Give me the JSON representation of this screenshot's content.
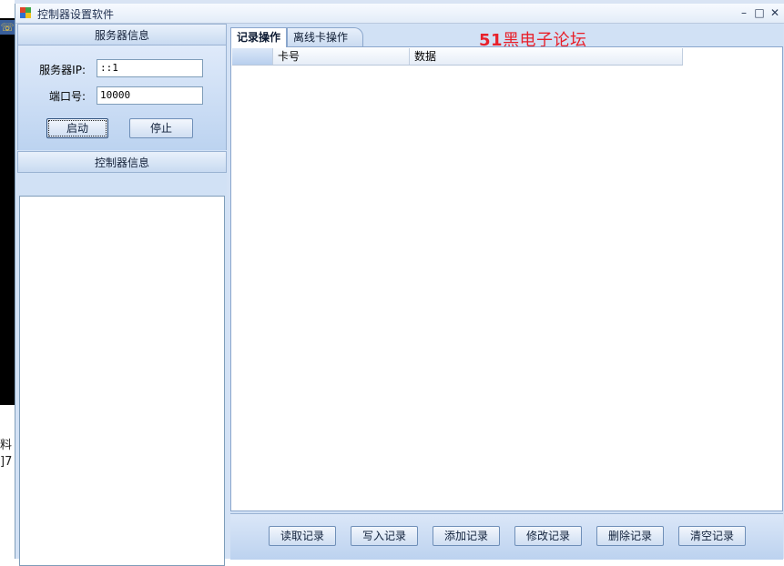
{
  "background": {
    "text_lines": [
      "料",
      "]7"
    ]
  },
  "window": {
    "title": "控制器设置软件",
    "controls": {
      "minimize": "–",
      "maximize": "□",
      "close": "✕"
    }
  },
  "left_panel": {
    "server_header": "服务器信息",
    "server_ip_label": "服务器IP:",
    "server_ip_value": "::1",
    "port_label": "端口号:",
    "port_value": "10000",
    "start_button": "启动",
    "stop_button": "停止",
    "controller_header": "控制器信息"
  },
  "tabs": [
    {
      "label": "记录操作",
      "active": true
    },
    {
      "label": "离线卡操作",
      "active": false
    }
  ],
  "forum_text": {
    "prefix": "51",
    "suffix": "黑电子论坛"
  },
  "grid": {
    "columns": [
      "卡号",
      "数据"
    ]
  },
  "bottom_buttons": [
    "读取记录",
    "写入记录",
    "添加记录",
    "修改记录",
    "删除记录",
    "清空记录"
  ],
  "colors": {
    "accent": "#d1e1f5",
    "forum_red": "#e8202a"
  }
}
